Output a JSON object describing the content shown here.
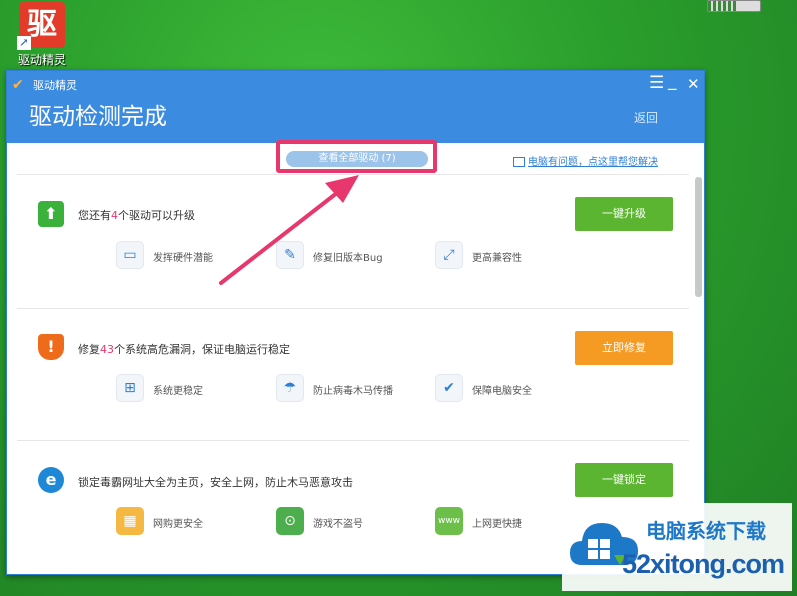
{
  "desktop": {
    "icon_glyph": "驱",
    "icon_label": "驱动精灵"
  },
  "window": {
    "app_name": "驱动精灵",
    "title": "驱动检测完成",
    "back_label": "返回",
    "menu_icon": "☰",
    "min_icon": "_",
    "close_icon": "✕"
  },
  "toolbar": {
    "view_all_label": "查看全部驱动 (7)",
    "help_link": "电脑有问题，点这里帮您解决"
  },
  "sections": [
    {
      "icon": "upgrade-icon",
      "text_before": "您还有",
      "highlight": "4",
      "text_after": "个驱动可以升级",
      "action": "一键升级",
      "action_color": "#5cb531",
      "features": [
        {
          "icon": "monitor-icon",
          "label": "发挥硬件潜能"
        },
        {
          "icon": "wrench-icon",
          "label": "修复旧版本Bug"
        },
        {
          "icon": "expand-icon",
          "label": "更高兼容性"
        }
      ]
    },
    {
      "icon": "shield-icon",
      "text_before": "修复",
      "highlight": "43",
      "text_after": "个系统高危漏洞，保证电脑运行稳定",
      "action": "立即修复",
      "action_color": "#f59a23",
      "features": [
        {
          "icon": "windows-icon",
          "label": "系统更稳定"
        },
        {
          "icon": "umbrella-icon",
          "label": "防止病毒木马传播"
        },
        {
          "icon": "shield-check-icon",
          "label": "保障电脑安全"
        }
      ]
    },
    {
      "icon": "ie-icon",
      "text_before": "锁定毒霸网址大全为主页，安全上网，防止木马恶意攻击",
      "highlight": "",
      "text_after": "",
      "action": "一键锁定",
      "action_color": "#5cb531",
      "features": [
        {
          "icon": "basket-icon",
          "label": "网购更安全"
        },
        {
          "icon": "gamepad-icon",
          "label": "游戏不盗号"
        },
        {
          "icon": "www-icon",
          "label": "上网更快捷"
        }
      ]
    }
  ],
  "watermark": {
    "cn": "电脑系统下载",
    "en": "52xitong.com"
  },
  "colors": {
    "titlebar": "#3b8be0",
    "highlight_box": "#e8376d",
    "green_button": "#5cb531",
    "orange_button": "#f59a23"
  }
}
